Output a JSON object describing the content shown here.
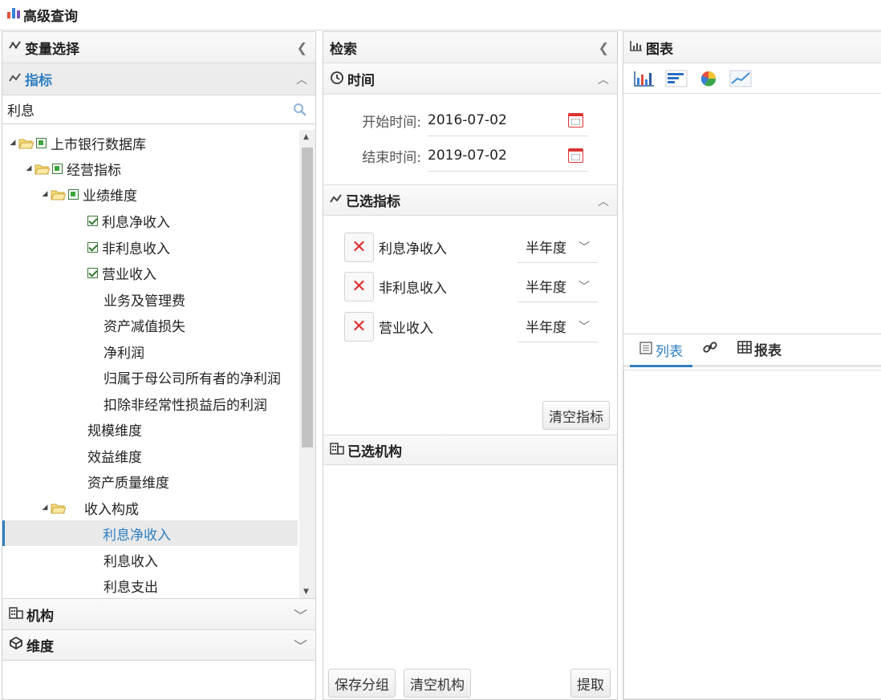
{
  "app": {
    "title": "高级查询"
  },
  "left": {
    "title": "变量选择",
    "indicator_section": "指标",
    "search": {
      "value": "利息",
      "placeholder": ""
    },
    "tree": {
      "root": "上市银行数据库",
      "level1": "经营指标",
      "level2": "业绩维度",
      "checked_items": [
        "利息净收入",
        "非利息收入",
        "营业收入"
      ],
      "unchecked_items": [
        "业务及管理费",
        "资产减值损失",
        "净利润",
        "归属于母公司所有者的净利润",
        "扣除非经常性损益后的利润"
      ],
      "dimensions": [
        "规模维度",
        "效益维度",
        "资产质量维度"
      ],
      "income_folder": "收入构成",
      "income_items": [
        "利息净收入",
        "利息收入",
        "利息支出"
      ]
    },
    "org_section": "机构",
    "dim_section": "维度"
  },
  "middle": {
    "title": "检索",
    "time_section": "时间",
    "start_label": "开始时间:",
    "start_value": "2016-07-02",
    "end_label": "结束时间:",
    "end_value": "2019-07-02",
    "selected_indicators_title": "已选指标",
    "indicators": [
      {
        "name": "利息净收入",
        "period": "半年度"
      },
      {
        "name": "非利息收入",
        "period": "半年度"
      },
      {
        "name": "营业收入",
        "period": "半年度"
      }
    ],
    "clear_indicators": "清空指标",
    "selected_orgs_title": "已选机构",
    "save_group": "保存分组",
    "clear_orgs": "清空机构",
    "extract": "提取"
  },
  "right": {
    "chart_title": "图表",
    "tabs": {
      "list": "列表",
      "report": "报表"
    }
  },
  "colors": {
    "accent": "#2e7fc1",
    "remove": "#e03030",
    "check": "#3aa63a"
  }
}
